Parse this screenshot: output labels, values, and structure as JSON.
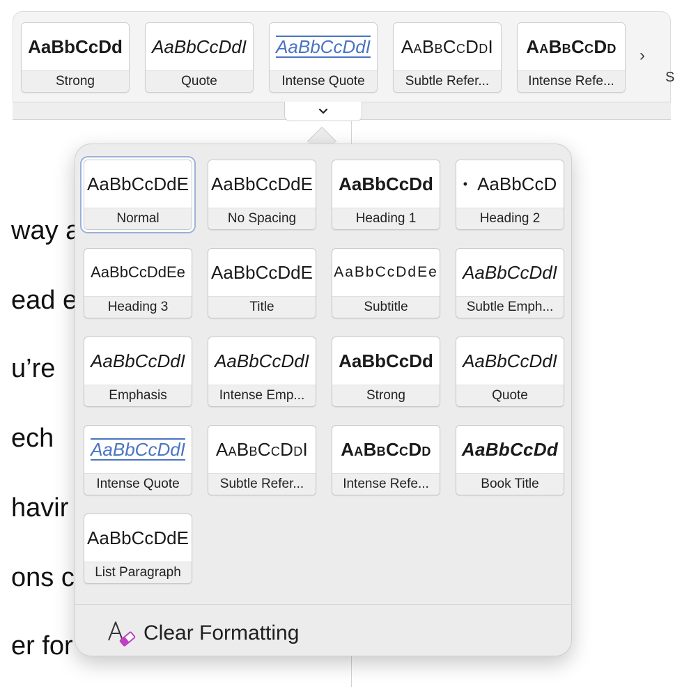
{
  "ribbon": {
    "tiles": [
      {
        "preview": "AaBbCcDd",
        "label": "Strong"
      },
      {
        "preview": "AaBbCcDdI",
        "label": "Quote"
      },
      {
        "preview": "AaBbCcDdI",
        "label": "Intense Quote"
      },
      {
        "preview": "AaBbCcDdI",
        "label": "Subtle Refer..."
      },
      {
        "preview": "AaBbCcDd",
        "label": "Intense Refe..."
      }
    ],
    "next_glyph": "›",
    "edge_glyph": "S"
  },
  "document": {
    "lines": [
      "way a",
      "ead e",
      "u’re",
      "ech",
      "havir",
      "ons c",
      "er for"
    ]
  },
  "gallery": {
    "styles": [
      {
        "preview": "AaBbCcDdE",
        "label": "Normal",
        "selected": true
      },
      {
        "preview": "AaBbCcDdE",
        "label": "No Spacing"
      },
      {
        "preview": "AaBbCcDd",
        "label": "Heading 1"
      },
      {
        "preview": "AaBbCcD",
        "label": "Heading 2"
      },
      {
        "preview": "AaBbCcDdEe",
        "label": "Heading 3"
      },
      {
        "preview": "AaBbCcDdE",
        "label": "Title"
      },
      {
        "preview": "AaBbCcDdEe",
        "label": "Subtitle"
      },
      {
        "preview": "AaBbCcDdI",
        "label": "Subtle Emph..."
      },
      {
        "preview": "AaBbCcDdI",
        "label": "Emphasis"
      },
      {
        "preview": "AaBbCcDdI",
        "label": "Intense Emp..."
      },
      {
        "preview": "AaBbCcDd",
        "label": "Strong"
      },
      {
        "preview": "AaBbCcDdI",
        "label": "Quote"
      },
      {
        "preview": "AaBbCcDdI",
        "label": "Intense Quote"
      },
      {
        "preview": "AaBbCcDdI",
        "label": "Subtle Refer..."
      },
      {
        "preview": "AaBbCcDd",
        "label": "Intense Refe..."
      },
      {
        "preview": "AaBbCcDd",
        "label": "Book Title"
      },
      {
        "preview": "AaBbCcDdE",
        "label": "List Paragraph"
      }
    ],
    "heading2_bullet": "•",
    "clear_formatting": "Clear Formatting"
  },
  "colors": {
    "accent_blue": "#4a74c4",
    "selection_ring": "#9ab2d8",
    "eraser_magenta": "#c13fc4"
  },
  "icons": {
    "ribbon_next": "chevron-right-icon",
    "expand": "chevron-down-icon",
    "clear": "clear-formatting-icon"
  }
}
